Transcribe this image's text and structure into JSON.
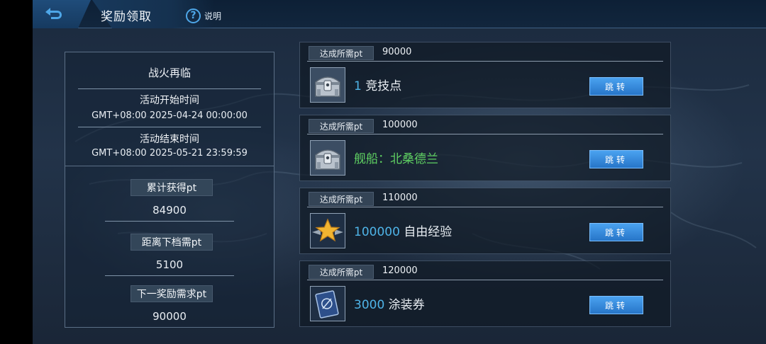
{
  "header": {
    "title": "奖励领取",
    "help_label": "说明",
    "back_icon": "back-arrow-icon",
    "help_icon": "question-mark-icon",
    "accent_color": "#4ea7e8"
  },
  "info": {
    "event_name": "战火再临",
    "start_label": "活动开始时间",
    "start_value": "GMT+08:00 2025-04-24 00:00:00",
    "end_label": "活动结束时间",
    "end_value": "GMT+08:00 2025-05-21 23:59:59",
    "total_label": "累计获得pt",
    "total_value": "84900",
    "next_gap_label": "距离下档需pt",
    "next_gap_value": "5100",
    "next_req_label": "下一奖励需求pt",
    "next_req_value": "90000"
  },
  "rewards": [
    {
      "req_label": "达成所需pt",
      "req_value": "90000",
      "icon": "silver-chest-icon",
      "amount": "1",
      "name": "竞技点",
      "button": "跳转"
    },
    {
      "req_label": "达成所需pt",
      "req_value": "100000",
      "icon": "silver-chest-icon",
      "amount": "",
      "name": "舰船：北桑德兰",
      "name_color": "#5fd062",
      "button": "跳转"
    },
    {
      "req_label": "达成所需pt",
      "req_value": "110000",
      "icon": "gold-star-icon",
      "amount": "100000",
      "name": "自由经验",
      "button": "跳转"
    },
    {
      "req_label": "达成所需pt",
      "req_value": "120000",
      "icon": "camouflage-card-icon",
      "amount": "3000",
      "name": "涂装券",
      "button": "跳转"
    }
  ]
}
